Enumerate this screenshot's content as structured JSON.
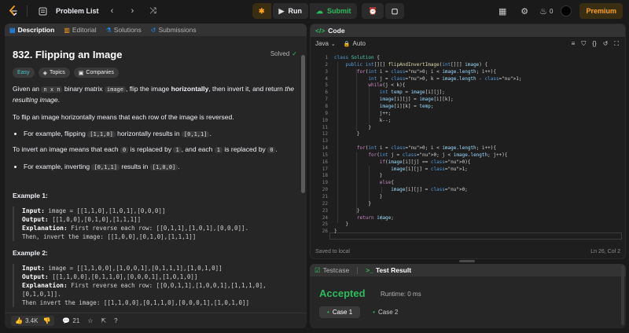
{
  "nav": {
    "title": "Problem List",
    "run_label": "Run",
    "submit_label": "Submit",
    "streak_count": "0",
    "premium_label": "Premium"
  },
  "left_tabs": [
    {
      "label": "Description",
      "icon": "document-icon"
    },
    {
      "label": "Editorial",
      "icon": "book-icon"
    },
    {
      "label": "Solutions",
      "icon": "flask-icon"
    },
    {
      "label": "Submissions",
      "icon": "history-icon"
    }
  ],
  "problem": {
    "title": "832. Flipping an Image",
    "status": "Solved",
    "tags": [
      "Easy",
      "Topics",
      "Companies"
    ],
    "p1_a": "Given an",
    "p1_c1": "n x n",
    "p1_b": "binary matrix",
    "p1_c2": "image",
    "p1_c": ", flip the image",
    "p1_bold": "horizontally",
    "p1_d": ", then invert it, and return",
    "p1_italic": "the resulting image",
    "p1_e": ".",
    "p2": "To flip an image horizontally means that each row of the image is reversed.",
    "b1_a": "For example, flipping",
    "b1_c1": "[1,1,0]",
    "b1_b": "horizontally results in",
    "b1_c2": "[0,1,1]",
    "b1_c": ".",
    "p3_a": "To invert an image means that each",
    "p3_c1": "0",
    "p3_b": "is replaced by",
    "p3_c2": "1",
    "p3_c": ", and each",
    "p3_c3": "1",
    "p3_d": "is replaced by",
    "p3_c4": "0",
    "p3_e": ".",
    "b2_a": "For example, inverting",
    "b2_c1": "[0,1,1]",
    "b2_b": "results in",
    "b2_c2": "[1,0,0]",
    "b2_c": ".",
    "ex1_title": "Example 1:",
    "ex1_input_label": "Input:",
    "ex1_input": "image = [[1,1,0],[1,0,1],[0,0,0]]",
    "ex1_output_label": "Output:",
    "ex1_output": "[[1,0,0],[0,1,0],[1,1,1]]",
    "ex1_expl_label": "Explanation:",
    "ex1_expl1": "First reverse each row: [[0,1,1],[1,0,1],[0,0,0]].",
    "ex1_expl2": "Then, invert the image: [[1,0,0],[0,1,0],[1,1,1]]",
    "ex2_title": "Example 2:",
    "ex2_input_label": "Input:",
    "ex2_input": "image = [[1,1,0,0],[1,0,0,1],[0,1,1,1],[1,0,1,0]]",
    "ex2_output_label": "Output:",
    "ex2_output": "[[1,1,0,0],[0,1,1,0],[0,0,0,1],[1,0,1,0]]",
    "ex2_expl_label": "Explanation:",
    "ex2_expl1": "First reverse each row: [[0,0,1,1],[1,0,0,1],[1,1,1,0],",
    "ex2_expl2": "[0,1,0,1]].",
    "ex2_expl3": "Then invert the image: [[1,1,0,0],[0,1,1,0],[0,0,0,1],[1,0,1,0]]",
    "likes": "3.4K",
    "comments": "21"
  },
  "code_panel": {
    "title": "Code",
    "language": "Java",
    "mode": "Auto",
    "saved": "Saved to local",
    "cursor": "Ln 26, Col 2"
  },
  "result_panel": {
    "tab_testcase": "Testcase",
    "tab_result": "Test Result",
    "status": "Accepted",
    "runtime": "Runtime: 0 ms",
    "case1": "Case 1",
    "case2": "Case 2"
  }
}
